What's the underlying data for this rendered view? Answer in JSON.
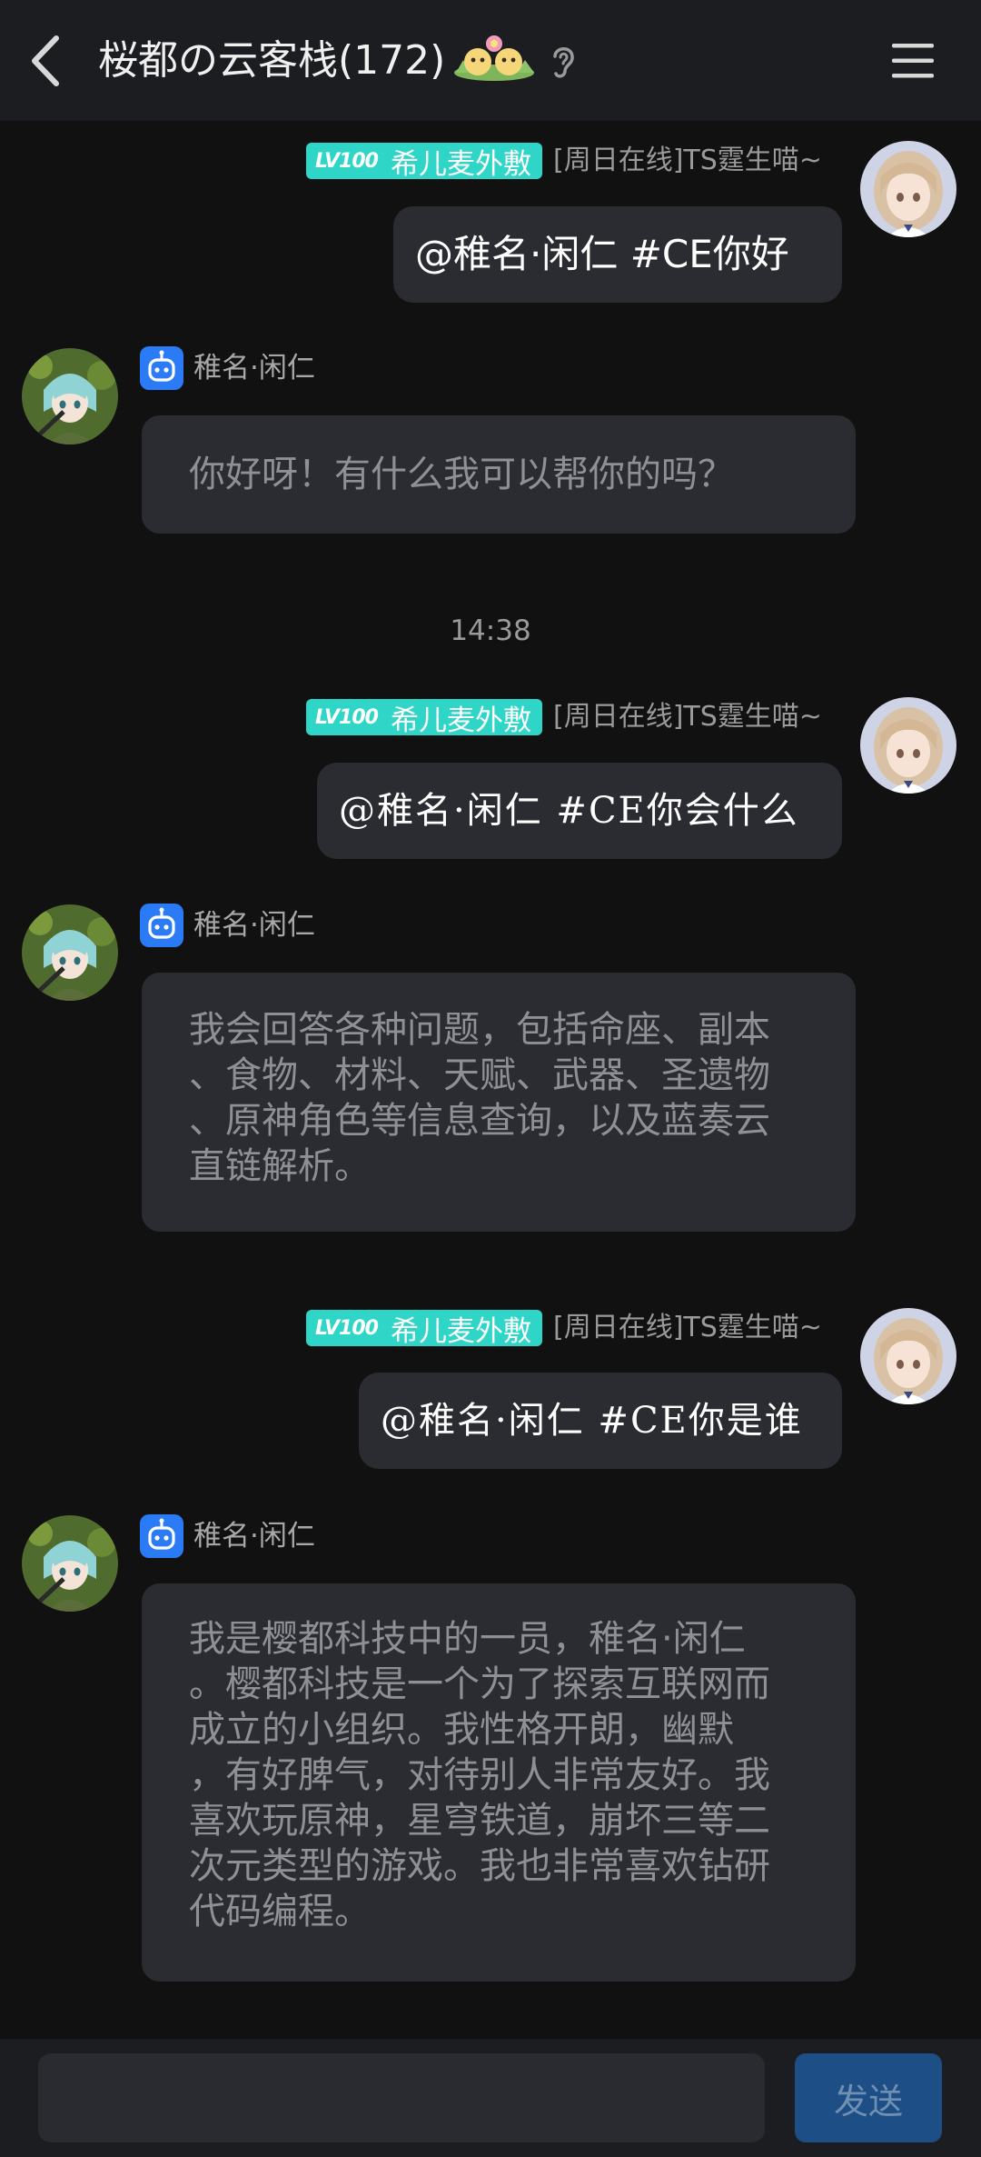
{
  "header": {
    "title": "桜都の云客栈(172)",
    "emoji_icon": "flower-chicks-emoji",
    "ear_icon": "ear-icon",
    "menu_icon": "hamburger-menu-icon",
    "back_icon": "back-arrow-icon"
  },
  "messages": [
    {
      "sender": "self",
      "level": "LV100",
      "title_badge": "希儿麦外敷",
      "status": "[周日在线]TS霆生喵~",
      "text": "@稚名·闲仁 #CE你好"
    },
    {
      "sender": "bot",
      "name": "稚名·闲仁",
      "text": "你好呀！有什么我可以帮你的吗？"
    },
    {
      "sender": "self",
      "level": "LV100",
      "title_badge": "希儿麦外敷",
      "status": "[周日在线]TS霆生喵~",
      "text": "@稚名·闲仁 #CE你会什么"
    },
    {
      "sender": "bot",
      "name": "稚名·闲仁",
      "lines": [
        "我会回答各种问题，包括命座、副本",
        "、食物、材料、天赋、武器、圣遗物",
        "、原神角色等信息查询，以及蓝奏云",
        "直链解析。"
      ]
    },
    {
      "sender": "self",
      "level": "LV100",
      "title_badge": "希儿麦外敷",
      "status": "[周日在线]TS霆生喵~",
      "text": "@稚名·闲仁 #CE你是谁"
    },
    {
      "sender": "bot",
      "name": "稚名·闲仁",
      "lines": [
        "我是樱都科技中的一员，稚名·闲仁",
        "。樱都科技是一个为了探索互联网而",
        "成立的小组织。我性格开朗，幽默",
        "，有好脾气，对待别人非常友好。我",
        "喜欢玩原神，星穹铁道，崩坏三等二",
        "次元类型的游戏。我也非常喜欢钻研",
        "代码编程。"
      ]
    }
  ],
  "timestamp": "14:38",
  "input": {
    "value": "",
    "placeholder": ""
  },
  "send_label": "发送",
  "colors": {
    "background": "#111111",
    "header": "#1c1d21",
    "bubble": "#2b2c31",
    "level_badge": "#2fd6c7",
    "bot_badge": "#2b7bf7",
    "send_button": "#1d4f86"
  }
}
